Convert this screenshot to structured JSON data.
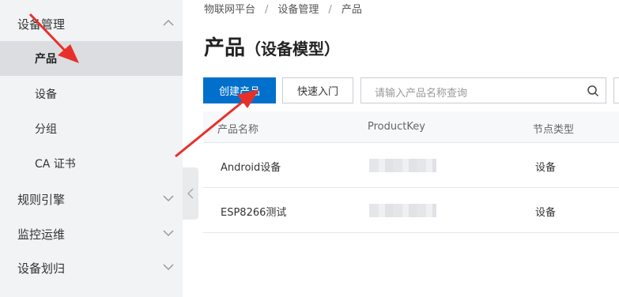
{
  "sidebar": {
    "groups": [
      {
        "label": "设备管理",
        "expanded": true
      },
      {
        "label": "规则引擎",
        "expanded": false
      },
      {
        "label": "监控运维",
        "expanded": false
      },
      {
        "label": "设备划归",
        "expanded": false
      }
    ],
    "sub_items": [
      {
        "label": "产品",
        "active": true
      },
      {
        "label": "设备",
        "active": false
      },
      {
        "label": "分组",
        "active": false
      },
      {
        "label": "CA 证书",
        "active": false
      }
    ]
  },
  "breadcrumb": [
    "物联网平台",
    "设备管理",
    "产品"
  ],
  "breadcrumb_separator": "/",
  "page": {
    "title": "产品",
    "subtitle": "（设备模型）"
  },
  "toolbar": {
    "create_label": "创建产品",
    "quickstart_label": "快速入门"
  },
  "search": {
    "placeholder": "请输入产品名称查询"
  },
  "table": {
    "columns": [
      "产品名称",
      "ProductKey",
      "节点类型"
    ],
    "rows": [
      {
        "name": "Android设备",
        "node_type": "设备"
      },
      {
        "name": "ESP8266测试",
        "node_type": "设备"
      }
    ]
  },
  "colors": {
    "primary": "#0070cc",
    "annotation_arrow": "#e8302a",
    "sidebar_bg": "#f2f3f5",
    "active_item_bg": "#dcdde0"
  }
}
